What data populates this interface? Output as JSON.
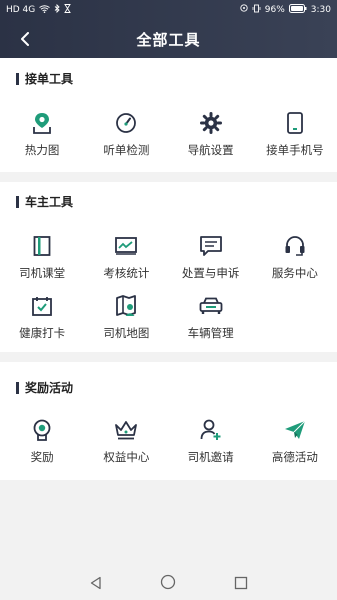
{
  "status": {
    "carrier": "HD 4G",
    "battery": "96%",
    "time": "3:30"
  },
  "header": {
    "title": "全部工具"
  },
  "sections": [
    {
      "title": "接单工具",
      "items": [
        {
          "label": "热力图",
          "icon": "map-pin-icon"
        },
        {
          "label": "听单检测",
          "icon": "gauge-icon"
        },
        {
          "label": "导航设置",
          "icon": "gear-icon"
        },
        {
          "label": "接单手机号",
          "icon": "phone-icon"
        }
      ]
    },
    {
      "title": "车主工具",
      "items": [
        {
          "label": "司机课堂",
          "icon": "book-icon"
        },
        {
          "label": "考核统计",
          "icon": "chart-icon"
        },
        {
          "label": "处置与申诉",
          "icon": "message-icon"
        },
        {
          "label": "服务中心",
          "icon": "headset-icon"
        },
        {
          "label": "健康打卡",
          "icon": "calendar-check-icon"
        },
        {
          "label": "司机地图",
          "icon": "driver-map-icon"
        },
        {
          "label": "车辆管理",
          "icon": "car-icon"
        }
      ]
    },
    {
      "title": "奖励活动",
      "items": [
        {
          "label": "奖励",
          "icon": "medal-icon"
        },
        {
          "label": "权益中心",
          "icon": "crown-icon"
        },
        {
          "label": "司机邀请",
          "icon": "user-add-icon"
        },
        {
          "label": "高德活动",
          "icon": "paper-plane-icon"
        }
      ]
    }
  ],
  "colors": {
    "header_bg": "#2b3245",
    "icon_dark": "#2b3245",
    "icon_accent": "#1f9c7a"
  }
}
